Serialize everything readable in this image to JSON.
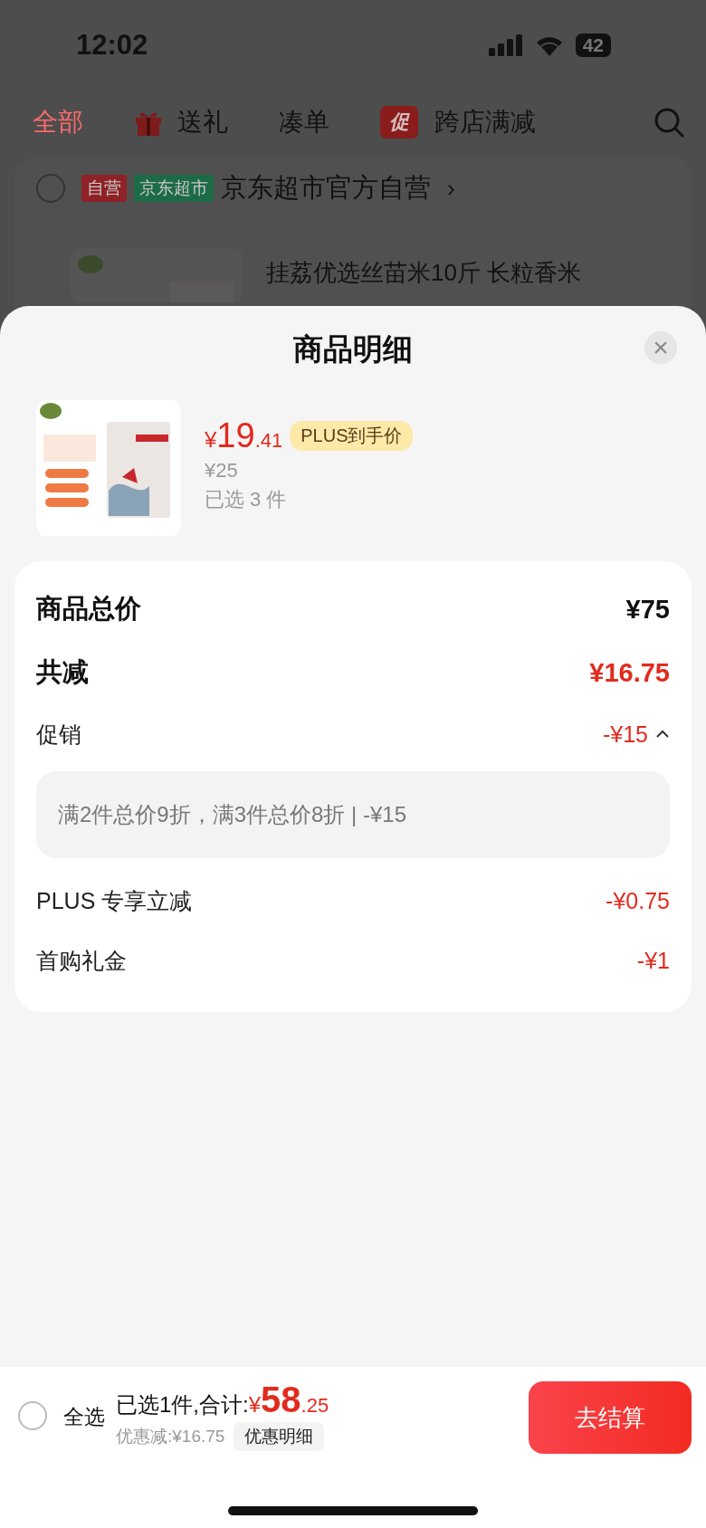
{
  "status_bar": {
    "time": "12:02",
    "battery": "42"
  },
  "filter_tabs": [
    {
      "kind": "plain",
      "label": "全部",
      "selected": true
    },
    {
      "kind": "gift",
      "label": "送礼",
      "selected": false
    },
    {
      "kind": "plain",
      "label": "凑单",
      "selected": false
    },
    {
      "kind": "badge",
      "badge": "促",
      "label": "跨店满减",
      "selected": false
    }
  ],
  "store": {
    "checked": false,
    "tags": [
      {
        "text": "自营",
        "color": "#8f2226"
      },
      {
        "text": "京东超市",
        "color": "#1d6b46"
      }
    ],
    "name": "京东超市官方自营",
    "chevron": "›"
  },
  "product_behind": {
    "title": "挂荔优选丝苗米10斤 长粒香米"
  },
  "sheet": {
    "title": "商品明细",
    "close": "×",
    "product": {
      "currency": "¥",
      "price_int": "19",
      "price_dec": ".41",
      "price_tag": "PLUS到手价",
      "original_price": "¥25",
      "selected_count": "已选 3 件"
    },
    "summary": [
      {
        "kind": "heading",
        "label": "商品总价",
        "value": "¥75",
        "highlight": false
      },
      {
        "kind": "heading",
        "label": "共减",
        "value": "¥16.75",
        "highlight": true
      },
      {
        "kind": "item",
        "label": "促销",
        "value": "-¥15",
        "expanded": true,
        "detail": "满2件总价9折，满3件总价8折 | -¥15"
      },
      {
        "kind": "item",
        "label": "PLUS 专享立减",
        "value": "-¥0.75"
      },
      {
        "kind": "item",
        "label": "首购礼金",
        "value": "-¥1"
      }
    ]
  },
  "bottom_bar": {
    "select_all": {
      "label": "全选",
      "checked": false
    },
    "summary": "已选1件,合计:",
    "currency": "¥",
    "total_int": "58",
    "total_dec": ".25",
    "saving": "优惠减:¥16.75",
    "detail_button": "优惠明细",
    "checkout": "去结算"
  }
}
